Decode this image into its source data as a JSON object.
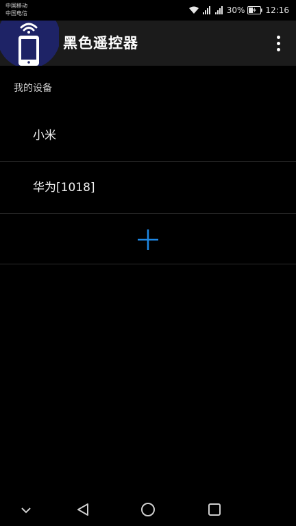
{
  "status_bar": {
    "carrier_1": "中国移动",
    "carrier_2": "中国电信",
    "battery": "30%",
    "time": "12:16"
  },
  "app_bar": {
    "title": "黑色遥控器",
    "logo_color": "#1e2366"
  },
  "section": {
    "label": "我的设备"
  },
  "devices": [
    {
      "label": "小米"
    },
    {
      "label": "华为[1018]"
    }
  ],
  "colors": {
    "background": "#000000",
    "app_bar": "#1b1b1b",
    "accent_add": "#1e88e5"
  },
  "icons": {
    "app_logo": "remote-phone-icon",
    "overflow": "more-vert-icon",
    "add": "plus-icon",
    "nav_collapse": "chevron-down-icon",
    "nav_back": "back-triangle-icon",
    "nav_home": "home-circle-icon",
    "nav_recents": "recents-square-icon"
  }
}
